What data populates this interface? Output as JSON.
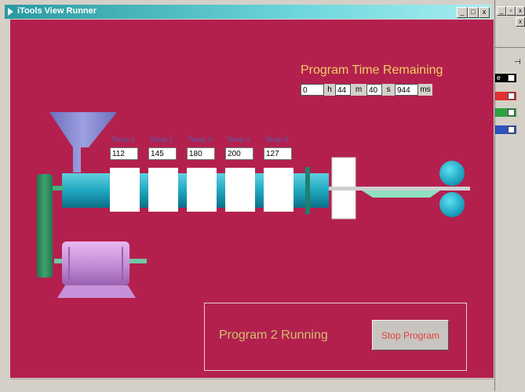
{
  "window": {
    "title": "iTools View Runner",
    "min": "_",
    "max": "□",
    "close": "x"
  },
  "program_time": {
    "title": "Program Time Remaining",
    "hours": "0",
    "hours_unit": "h",
    "minutes": "44",
    "minutes_unit": "m",
    "seconds": "40",
    "seconds_unit": "s",
    "ms": "944",
    "ms_unit": "ms"
  },
  "zones": [
    {
      "label": "Temp 1",
      "value": "112"
    },
    {
      "label": "Temp 2",
      "value": "145"
    },
    {
      "label": "Temp 3",
      "value": "180"
    },
    {
      "label": "Temp 4",
      "value": "200"
    },
    {
      "label": "Temp 5",
      "value": "127"
    }
  ],
  "status": {
    "text": "Program 2 Running",
    "stop_label": "Stop Program"
  },
  "right_panel": {
    "item_label": "e",
    "colors": [
      "#e03030",
      "#30a040",
      "#3050c0"
    ]
  }
}
